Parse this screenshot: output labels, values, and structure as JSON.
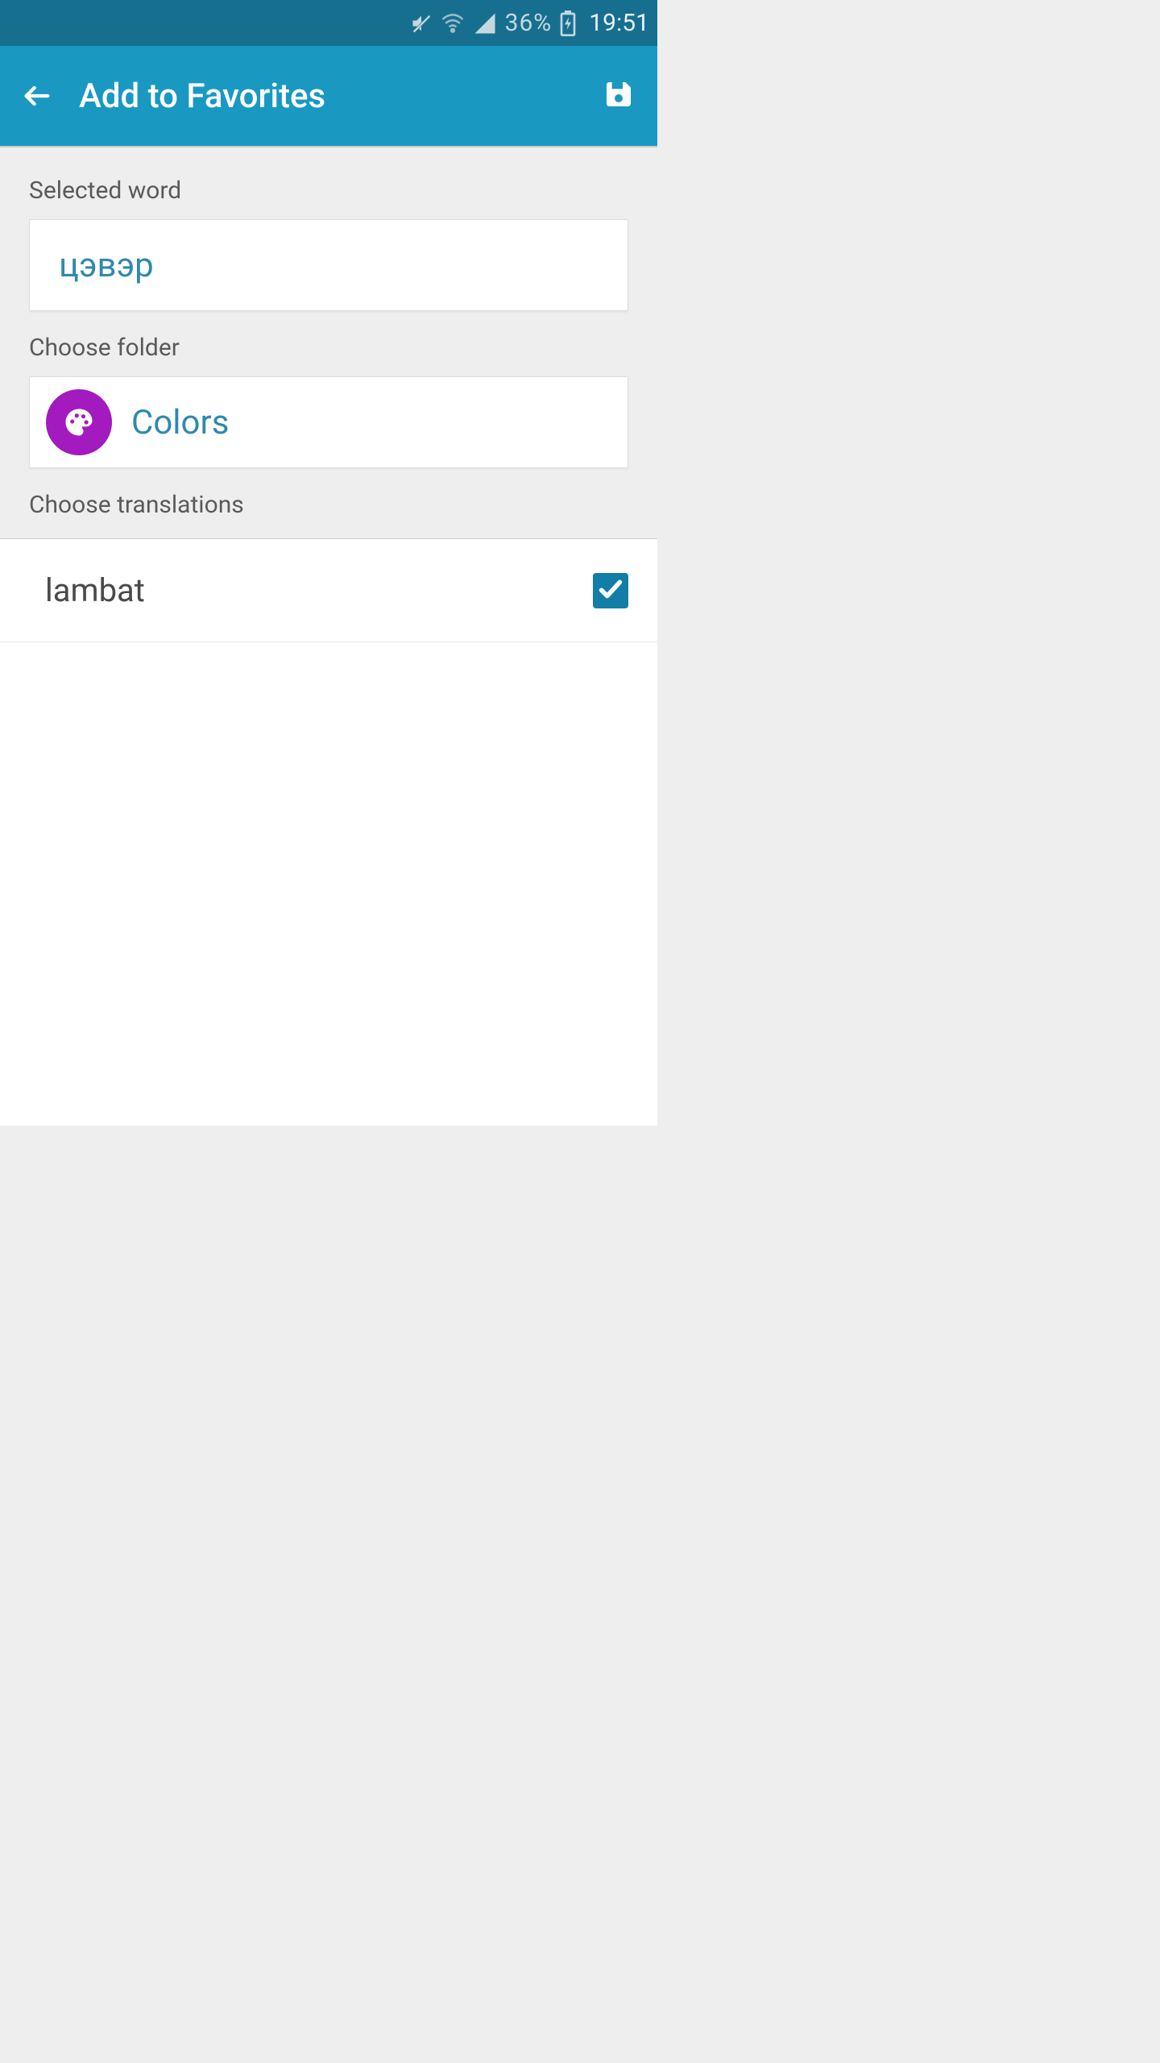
{
  "statusbar": {
    "battery": "36%",
    "time": "19:51",
    "icons": {
      "mute": "volume-mute",
      "wifi": "wifi",
      "signal": "cellular",
      "charging": true
    }
  },
  "appbar": {
    "title": "Add to Favorites",
    "back_label": "Back",
    "save_label": "Save"
  },
  "labels": {
    "selected_word": "Selected word",
    "choose_folder": "Choose folder",
    "choose_translations": "Choose translations"
  },
  "selected_word": "цэвэр",
  "folder": {
    "name": "Colors",
    "icon": "palette"
  },
  "translations": [
    {
      "text": "lambat",
      "checked": true
    }
  ],
  "colors": {
    "accent": "#1999c2",
    "statusbar": "#176f90",
    "folder_avatar": "#a31abf"
  }
}
